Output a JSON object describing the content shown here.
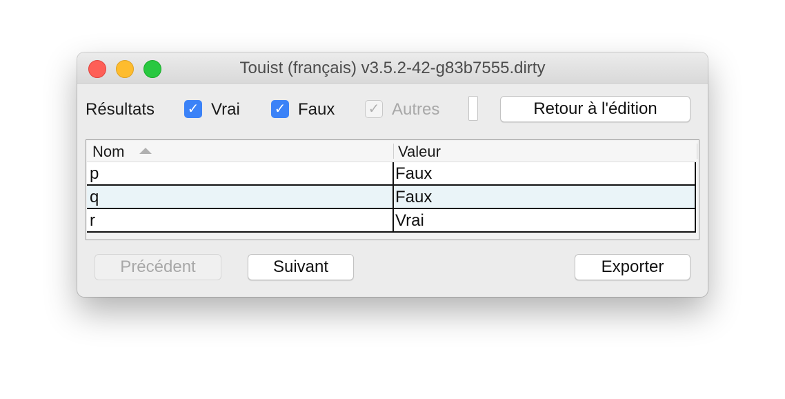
{
  "window": {
    "title": "Touist (français) v3.5.2-42-g83b7555.dirty"
  },
  "toolbar": {
    "results_label": "Résultats",
    "checkboxes": [
      {
        "label": "Vrai",
        "checked": true,
        "enabled": true
      },
      {
        "label": "Faux",
        "checked": true,
        "enabled": true
      },
      {
        "label": "Autres",
        "checked": true,
        "enabled": false
      }
    ],
    "back_button": "Retour à l'édition"
  },
  "table": {
    "columns": [
      "Nom",
      "Valeur"
    ],
    "sorted_column": "Nom",
    "rows": [
      {
        "nom": "p",
        "valeur": "Faux"
      },
      {
        "nom": "q",
        "valeur": "Faux"
      },
      {
        "nom": "r",
        "valeur": "Vrai"
      }
    ]
  },
  "footer": {
    "previous_button": "Précédent",
    "next_button": "Suivant",
    "export_button": "Exporter"
  },
  "colors": {
    "accent": "#3b82f7",
    "selected_row": "#eaf4f8"
  }
}
